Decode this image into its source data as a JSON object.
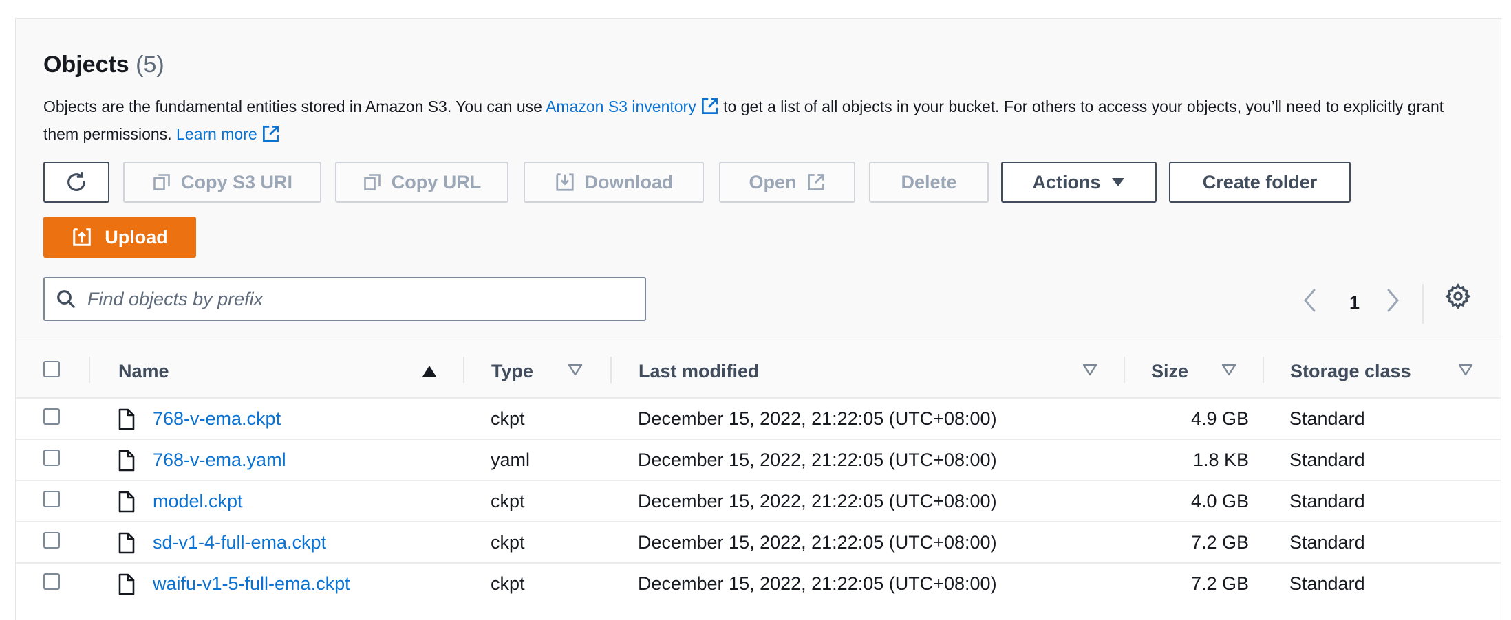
{
  "header": {
    "title": "Objects",
    "count": "(5)",
    "description_part1": "Objects are the fundamental entities stored in Amazon S3. You can use ",
    "inventory_link": "Amazon S3 inventory",
    "description_part2": " to get a list of all objects in your bucket. For others to access your objects, you’ll need to explicitly grant them permissions. ",
    "learn_more_link": "Learn more"
  },
  "toolbar": {
    "refresh_icon": "refresh-icon",
    "copy_s3_uri": "Copy S3 URI",
    "copy_url": "Copy URL",
    "download": "Download",
    "open": "Open",
    "delete": "Delete",
    "actions": "Actions",
    "create_folder": "Create folder",
    "upload": "Upload"
  },
  "search": {
    "placeholder": "Find objects by prefix",
    "value": ""
  },
  "pagination": {
    "current_page": "1"
  },
  "table": {
    "columns": {
      "name": "Name",
      "type": "Type",
      "last_modified": "Last modified",
      "size": "Size",
      "storage_class": "Storage class"
    },
    "sort": {
      "column": "Name",
      "direction": "ascending"
    },
    "rows": [
      {
        "name": "768-v-ema.ckpt",
        "type": "ckpt",
        "last_modified": "December 15, 2022, 21:22:05 (UTC+08:00)",
        "size": "4.9 GB",
        "storage_class": "Standard"
      },
      {
        "name": "768-v-ema.yaml",
        "type": "yaml",
        "last_modified": "December 15, 2022, 21:22:05 (UTC+08:00)",
        "size": "1.8 KB",
        "storage_class": "Standard"
      },
      {
        "name": "model.ckpt",
        "type": "ckpt",
        "last_modified": "December 15, 2022, 21:22:05 (UTC+08:00)",
        "size": "4.0 GB",
        "storage_class": "Standard"
      },
      {
        "name": "sd-v1-4-full-ema.ckpt",
        "type": "ckpt",
        "last_modified": "December 15, 2022, 21:22:05 (UTC+08:00)",
        "size": "7.2 GB",
        "storage_class": "Standard"
      },
      {
        "name": "waifu-v1-5-full-ema.ckpt",
        "type": "ckpt",
        "last_modified": "December 15, 2022, 21:22:05 (UTC+08:00)",
        "size": "7.2 GB",
        "storage_class": "Standard"
      }
    ]
  },
  "colors": {
    "link": "#0972d3",
    "upload_bg": "#ec7211",
    "text": "#16191f",
    "muted": "#5f6b7a",
    "disabled": "#9ba7b6"
  }
}
